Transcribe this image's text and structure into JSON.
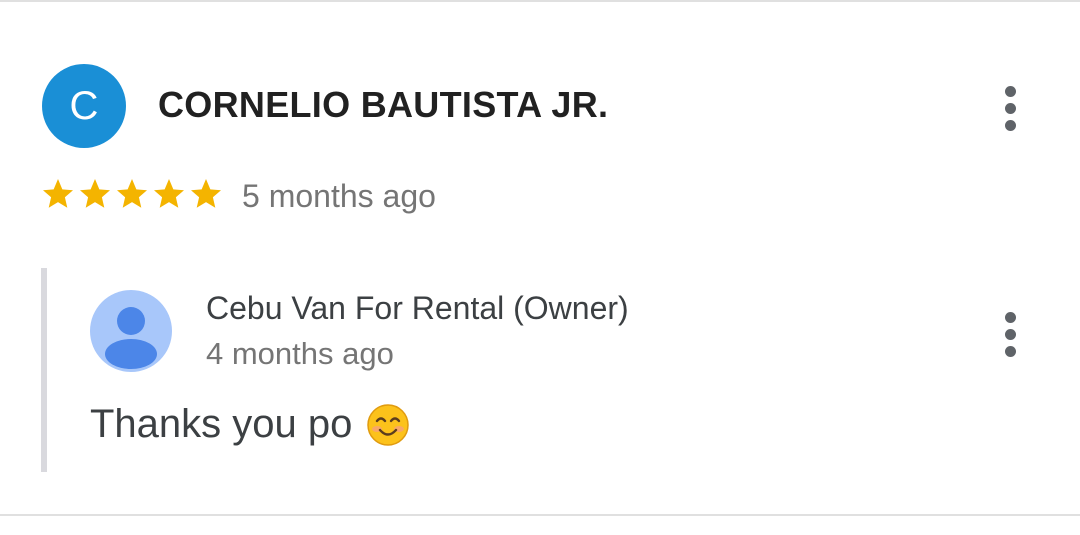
{
  "review": {
    "avatar_letter": "C",
    "avatar_color": "#1a8fd6",
    "reviewer_name": "CORNELIO BAUTISTA JR.",
    "rating": 5,
    "max_rating": 5,
    "time": "5 months ago",
    "star_color": "#f4b400"
  },
  "reply": {
    "owner_name": "Cebu Van For Rental (Owner)",
    "time": "4 months ago",
    "text": "Thanks you po",
    "emoji_icon": "smiling-face-icon",
    "avatar_icon": "default-person-icon"
  }
}
